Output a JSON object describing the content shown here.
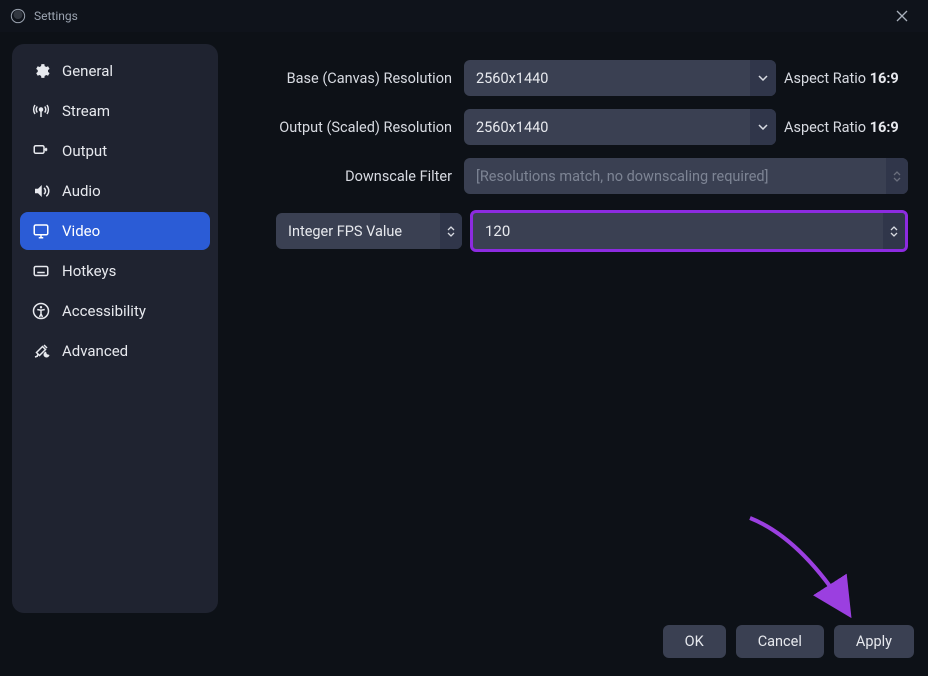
{
  "titlebar": {
    "title": "Settings"
  },
  "sidebar": {
    "items": [
      {
        "label": "General"
      },
      {
        "label": "Stream"
      },
      {
        "label": "Output"
      },
      {
        "label": "Audio"
      },
      {
        "label": "Video"
      },
      {
        "label": "Hotkeys"
      },
      {
        "label": "Accessibility"
      },
      {
        "label": "Advanced"
      }
    ]
  },
  "form": {
    "base_label": "Base (Canvas) Resolution",
    "base_value": "2560x1440",
    "base_aspect_label": "Aspect Ratio",
    "base_aspect_value": "16:9",
    "output_label": "Output (Scaled) Resolution",
    "output_value": "2560x1440",
    "output_aspect_label": "Aspect Ratio",
    "output_aspect_value": "16:9",
    "downscale_label": "Downscale Filter",
    "downscale_value": "[Resolutions match, no downscaling required]",
    "fps_type_label": "Integer FPS Value",
    "fps_value": "120"
  },
  "footer": {
    "ok": "OK",
    "cancel": "Cancel",
    "apply": "Apply"
  }
}
